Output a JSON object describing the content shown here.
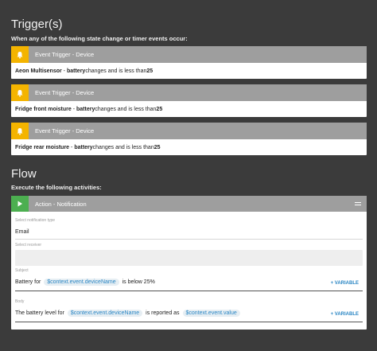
{
  "triggers": {
    "title": "Trigger(s)",
    "subtitle": "When any of the following state change or timer events occur:",
    "cards": [
      {
        "header": "Event Trigger - Device",
        "device": "Aeon Multisensor",
        "attribute": "battery",
        "condition": " changes and is less than ",
        "value": "25"
      },
      {
        "header": "Event Trigger - Device",
        "device": "Fridge front moisture",
        "attribute": "battery",
        "condition": " changes and is less than ",
        "value": "25"
      },
      {
        "header": "Event Trigger - Device",
        "device": "Fridge rear moisture",
        "attribute": "battery",
        "condition": " changes and is less than ",
        "value": "25"
      }
    ]
  },
  "flow": {
    "title": "Flow",
    "subtitle": "Execute the following activities:",
    "action": {
      "header": "Action - Notification",
      "notification_type_label": "Select notification type",
      "notification_type_value": "Email",
      "receiver_label": "Select receiver",
      "subject_label": "Subject",
      "subject": {
        "prefix": "Battery for ",
        "chip": "$context.event.deviceName",
        "suffix": " is below 25%"
      },
      "body_label": "Body",
      "body": {
        "prefix": "The battery level for ",
        "chip1": "$context.event.deviceName",
        "middle": " is reported as ",
        "chip2": "$context.event.value"
      },
      "variable_label": "+ VARIABLE"
    }
  },
  "colors": {
    "trigger_accent": "#f4b400",
    "action_accent": "#4caf50",
    "header_gray": "#9e9e9e",
    "chip_text": "#2a86c4"
  }
}
